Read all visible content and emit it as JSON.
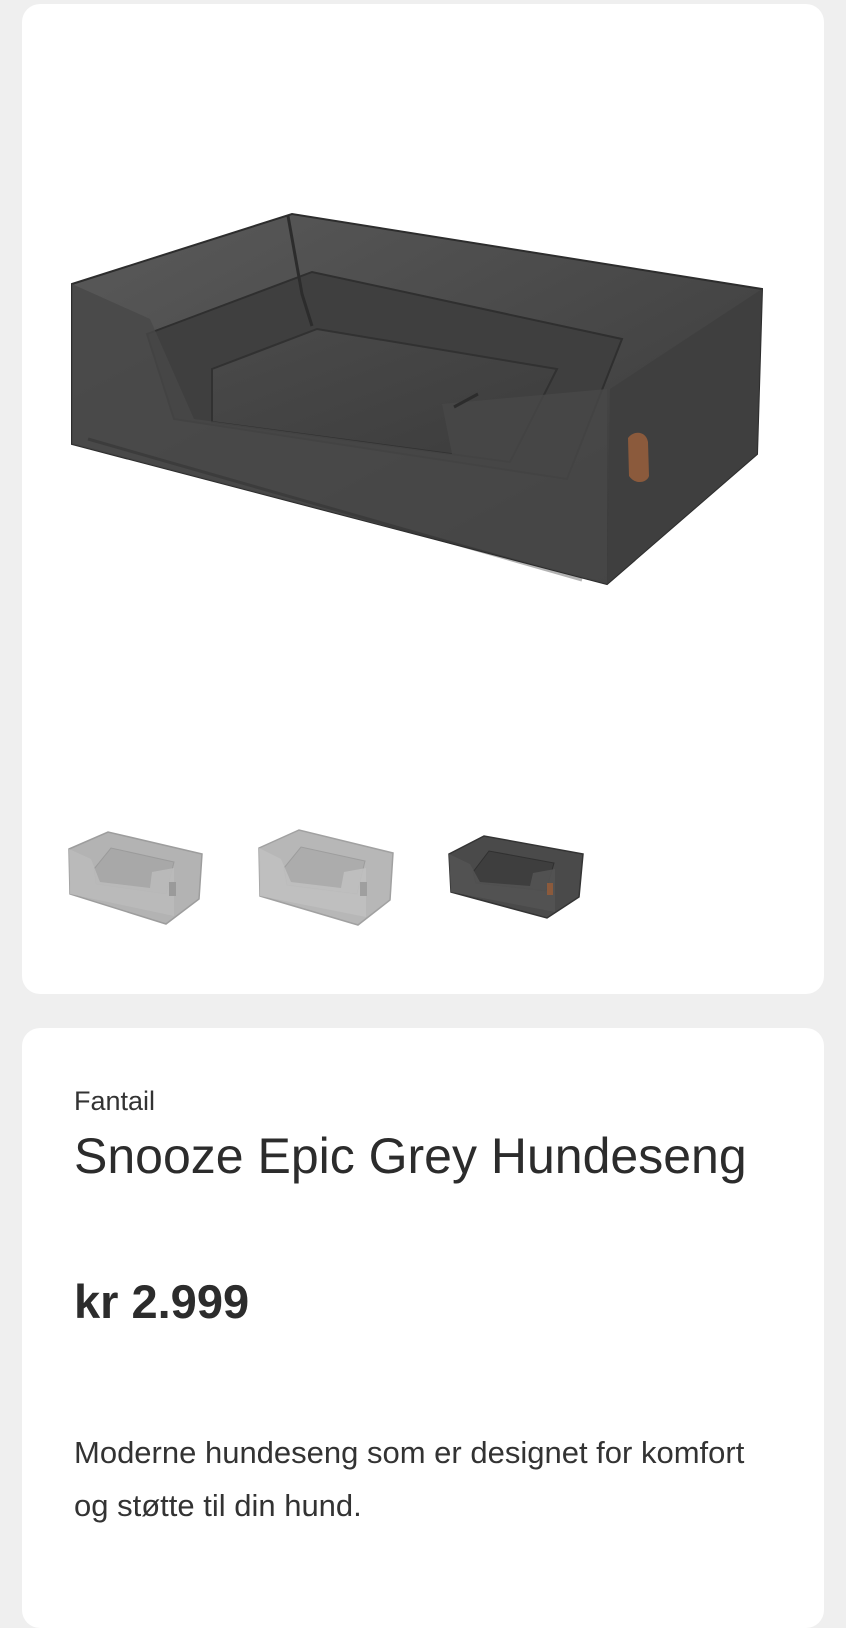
{
  "gallery": {
    "main_image": {
      "icon": "dog-bed-image",
      "color": "#4b4b4b",
      "selected_variant_index": 2
    },
    "thumbnails": [
      {
        "icon": "dog-bed-thumbnail",
        "color": "#b3b3b3"
      },
      {
        "icon": "dog-bed-thumbnail",
        "color": "#b7b7b7"
      },
      {
        "icon": "dog-bed-thumbnail",
        "color": "#4a4a4a"
      }
    ]
  },
  "product": {
    "brand": "Fantail",
    "title": "Snooze Epic Grey Hundeseng",
    "price": "kr 2.999",
    "description": "Moderne hundeseng som er designet for komfort og støtte til din hund."
  },
  "colors": {
    "background": "#efefef",
    "card": "#ffffff",
    "text": "#2f2f2f",
    "leather_tag": "#8b5a3c"
  }
}
